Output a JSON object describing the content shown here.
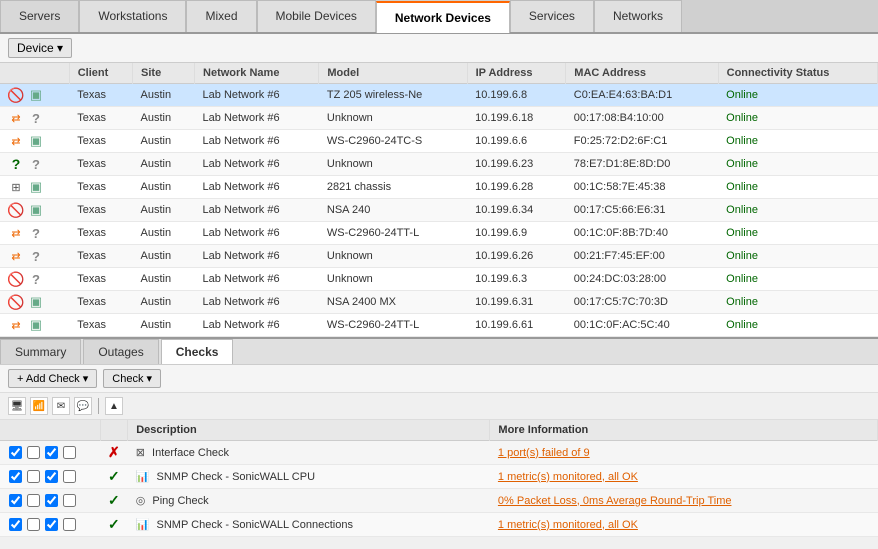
{
  "tabs": [
    {
      "label": "Servers",
      "active": false
    },
    {
      "label": "Workstations",
      "active": false
    },
    {
      "label": "Mixed",
      "active": false
    },
    {
      "label": "Mobile Devices",
      "active": false
    },
    {
      "label": "Network Devices",
      "active": true
    },
    {
      "label": "Services",
      "active": false
    },
    {
      "label": "Networks",
      "active": false
    }
  ],
  "toolbar": {
    "device_label": "Device ▾"
  },
  "table": {
    "columns": [
      "",
      "Client",
      "Site",
      "Network Name",
      "Model",
      "IP Address",
      "MAC Address",
      "Connectivity Status"
    ],
    "rows": [
      {
        "icons": [
          "red-ban",
          "cube"
        ],
        "client": "Texas",
        "site": "Austin",
        "network": "Lab Network #6",
        "model": "TZ 205 wireless-Ne",
        "ip": "10.199.6.8",
        "mac": "C0:EA:E4:63:BA:D1",
        "status": "Online",
        "selected": true
      },
      {
        "icons": [
          "orange-arrow",
          "question"
        ],
        "client": "Texas",
        "site": "Austin",
        "network": "Lab Network #6",
        "model": "Unknown",
        "ip": "10.199.6.18",
        "mac": "00:17:08:B4:10:00",
        "status": "Online",
        "selected": false
      },
      {
        "icons": [
          "orange-arrow",
          "cube"
        ],
        "client": "Texas",
        "site": "Austin",
        "network": "Lab Network #6",
        "model": "WS-C2960-24TC-S",
        "ip": "10.199.6.6",
        "mac": "F0:25:72:D2:6F:C1",
        "status": "Online",
        "selected": false
      },
      {
        "icons": [
          "green-question",
          "question"
        ],
        "client": "Texas",
        "site": "Austin",
        "network": "Lab Network #6",
        "model": "Unknown",
        "ip": "10.199.6.23",
        "mac": "78:E7:D1:8E:8D:D0",
        "status": "Online",
        "selected": false
      },
      {
        "icons": [
          "switch",
          "cube"
        ],
        "client": "Texas",
        "site": "Austin",
        "network": "Lab Network #6",
        "model": "2821 chassis",
        "ip": "10.199.6.28",
        "mac": "00:1C:58:7E:45:38",
        "status": "Online",
        "selected": false
      },
      {
        "icons": [
          "red-ban",
          "cube"
        ],
        "client": "Texas",
        "site": "Austin",
        "network": "Lab Network #6",
        "model": "NSA 240",
        "ip": "10.199.6.34",
        "mac": "00:17:C5:66:E6:31",
        "status": "Online",
        "selected": false
      },
      {
        "icons": [
          "orange-arrow",
          "question"
        ],
        "client": "Texas",
        "site": "Austin",
        "network": "Lab Network #6",
        "model": "WS-C2960-24TT-L",
        "ip": "10.199.6.9",
        "mac": "00:1C:0F:8B:7D:40",
        "status": "Online",
        "selected": false
      },
      {
        "icons": [
          "orange-arrow",
          "question"
        ],
        "client": "Texas",
        "site": "Austin",
        "network": "Lab Network #6",
        "model": "Unknown",
        "ip": "10.199.6.26",
        "mac": "00:21:F7:45:EF:00",
        "status": "Online",
        "selected": false
      },
      {
        "icons": [
          "red-ban",
          "question"
        ],
        "client": "Texas",
        "site": "Austin",
        "network": "Lab Network #6",
        "model": "Unknown",
        "ip": "10.199.6.3",
        "mac": "00:24:DC:03:28:00",
        "status": "Online",
        "selected": false
      },
      {
        "icons": [
          "red-ban",
          "cube"
        ],
        "client": "Texas",
        "site": "Austin",
        "network": "Lab Network #6",
        "model": "NSA 2400 MX",
        "ip": "10.199.6.31",
        "mac": "00:17:C5:7C:70:3D",
        "status": "Online",
        "selected": false
      },
      {
        "icons": [
          "orange-arrow",
          "cube"
        ],
        "client": "Texas",
        "site": "Austin",
        "network": "Lab Network #6",
        "model": "WS-C2960-24TT-L",
        "ip": "10.199.6.61",
        "mac": "00:1C:0F:AC:5C:40",
        "status": "Online",
        "selected": false
      }
    ]
  },
  "bottom_tabs": [
    {
      "label": "Summary",
      "active": false
    },
    {
      "label": "Outages",
      "active": false
    },
    {
      "label": "Checks",
      "active": true
    }
  ],
  "checks_toolbar": {
    "add_check": "+ Add Check ▾",
    "check": "Check ▾"
  },
  "checks_icons": [
    "monitor",
    "wifi",
    "mail",
    "chat"
  ],
  "checks_columns": [
    "",
    "",
    "Description",
    "More Information"
  ],
  "checks_rows": [
    {
      "cbs": [
        true,
        false,
        true,
        false
      ],
      "status": "x",
      "desc_icon": "network",
      "description": "Interface Check",
      "more_info": "1 port(s) failed of 9",
      "info_link": true,
      "info_color": "orange"
    },
    {
      "cbs": [
        true,
        false,
        true,
        false
      ],
      "status": "ok",
      "desc_icon": "snmp",
      "description": "SNMP Check - SonicWALL CPU",
      "more_info": "1 metric(s) monitored, all OK",
      "info_link": true,
      "info_color": "orange"
    },
    {
      "cbs": [
        true,
        false,
        true,
        false
      ],
      "status": "ok",
      "desc_icon": "ping",
      "description": "Ping Check",
      "more_info": "0% Packet Loss, 0ms Average Round-Trip Time",
      "info_link": true,
      "info_color": "orange"
    },
    {
      "cbs": [
        true,
        false,
        true,
        false
      ],
      "status": "ok",
      "desc_icon": "snmp",
      "description": "SNMP Check - SonicWALL Connections",
      "more_info": "1 metric(s) monitored, all OK",
      "info_link": true,
      "info_color": "orange"
    }
  ]
}
